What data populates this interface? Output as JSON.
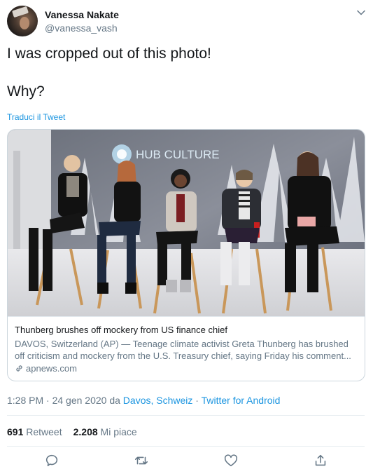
{
  "author": {
    "name": "Vanessa Nakate",
    "handle": "@vanessa_vash"
  },
  "tweet": {
    "line1": "I was cropped out of this photo!",
    "line2": "Why?",
    "translate_label": "Traduci il Tweet"
  },
  "card": {
    "image_logo_text": "HUB CULTURE",
    "title": "Thunberg brushes off mockery from US finance chief",
    "description": "DAVOS, Switzerland (AP) — Teenage climate activist Greta Thunberg has brushed off criticism and mockery from the U.S. Treasury chief, saying Friday his comment...",
    "domain": "apnews.com"
  },
  "meta": {
    "time_date": "1:28 PM · 24 gen 2020 da ",
    "location": "Davos, Schweiz",
    "separator": " · ",
    "source": "Twitter for Android"
  },
  "stats": {
    "retweets_count": "691",
    "retweets_label": "Retweet",
    "likes_count": "2.208",
    "likes_label": "Mi piace"
  },
  "icons": {
    "reply": "reply-icon",
    "retweet": "retweet-icon",
    "like": "like-icon",
    "share": "share-icon"
  },
  "colors": {
    "link": "#1b95e0",
    "secondary": "#657786",
    "primary": "#14171a",
    "border": "#ccd6dd"
  }
}
